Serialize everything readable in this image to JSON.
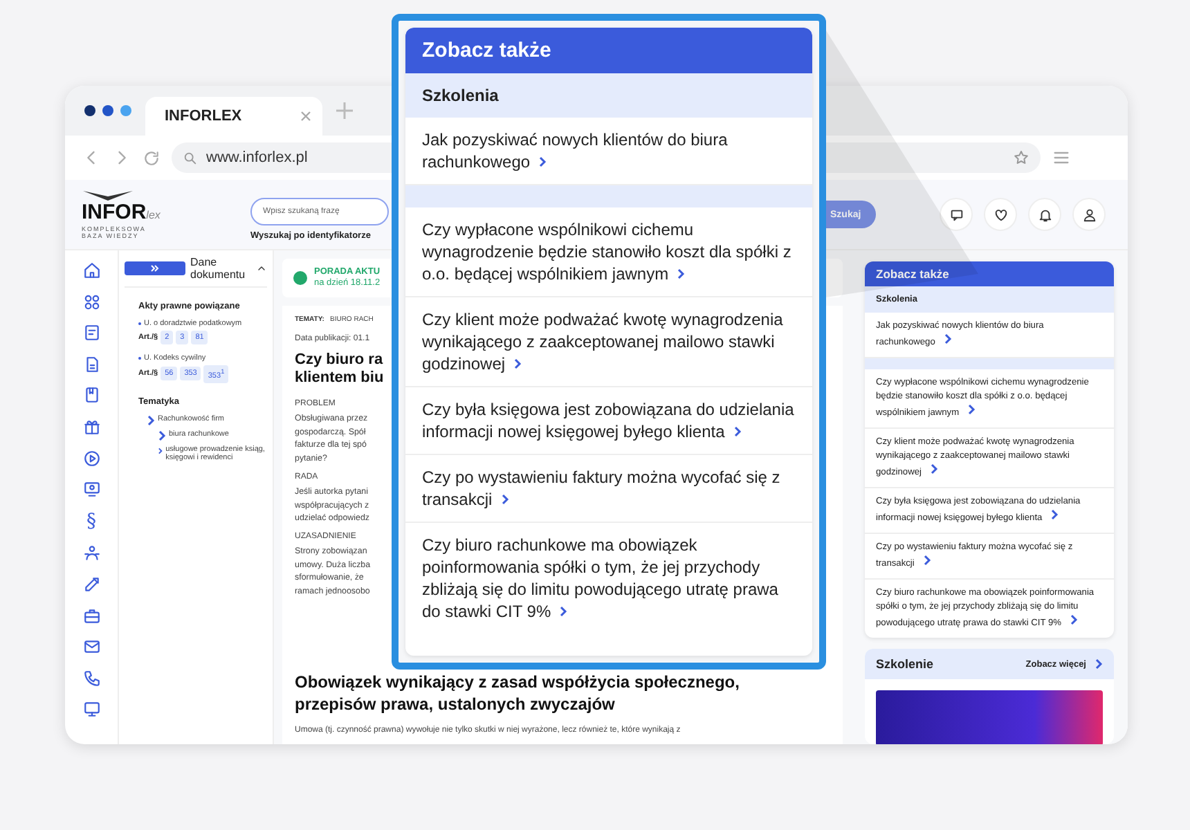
{
  "browser": {
    "tabs": [
      {
        "label": "INFORLEX",
        "selected": true
      }
    ],
    "url": "www.inforlex.pl"
  },
  "header": {
    "logo": {
      "brand": "INFOR",
      "suffix": "lex",
      "tagline_1": "KOMPLEKSOWA",
      "tagline_2": "BAZA WIEDZY"
    },
    "search": {
      "placeholder": "Wpisz szukaną frazę",
      "button": "Szukaj"
    },
    "id_search_link": "Wyszukaj po identyfikatorze"
  },
  "rail": {
    "symbol": "§"
  },
  "document_panel": {
    "title": "Dane dokumentu",
    "acts_title": "Akty prawne powiązane",
    "acts": [
      {
        "name": "U. o doradztwie podatkowym",
        "label": "Art./§",
        "articles": [
          "2",
          "3",
          "81"
        ]
      },
      {
        "name": "U. Kodeks cywilny",
        "label": "Art./§",
        "articles": [
          "56",
          "353",
          "353$^{1}$"
        ]
      }
    ],
    "topics_title": "Tematyka",
    "topics": [
      {
        "label": "Rachunkowość firm",
        "children": [
          {
            "label": "biura rachunkowe"
          },
          {
            "label": "usługowe prowadzenie ksiąg, księgowi i rewidenci"
          }
        ]
      }
    ]
  },
  "document": {
    "badge": {
      "title": "PORADA AKTU",
      "date": "na dzień 18.11.2"
    },
    "topics_label": "TEMATY:",
    "topics": "BIURO RACH",
    "published": "Data publikacji: 01.1",
    "title_lines": [
      "Czy biuro ra",
      "klientem biu"
    ],
    "blocks": [
      {
        "kind": "label",
        "lines": [
          "PROBLEM"
        ]
      },
      {
        "kind": "paragraph",
        "lines": [
          "Obsługiwana przez",
          "gospodarczą. Spół",
          "fakturze dla tej spó",
          "pytanie?"
        ]
      },
      {
        "kind": "label",
        "lines": [
          "RADA"
        ]
      },
      {
        "kind": "paragraph",
        "lines": [
          "Jeśli autorka pytani",
          "współpracujących z",
          "udzielać odpowiedz"
        ]
      },
      {
        "kind": "label",
        "lines": [
          "UZASADNIENIE"
        ]
      },
      {
        "kind": "paragraph",
        "lines": [
          "Strony zobowiązan",
          "umowy. Duża liczba",
          "sformułowanie, że",
          "ramach jednoosobo"
        ]
      }
    ],
    "heading_lines": [
      "Obowiązek wynikający z zasad współżycia społecznego,",
      "przepisów prawa, ustalonych zwyczajów"
    ],
    "body": "Umowa (tj. czynność prawna) wywołuje nie tylko skutki w niej wyrażone, lecz również te, które wynikają z"
  },
  "popup": {
    "title": "Zobacz także",
    "groups": [
      {
        "heading": "Szkolenia",
        "items": [
          "Jak pozyskiwać nowych klientów do biura rachunkowego"
        ]
      },
      {
        "items": [
          "Czy wypłacone wspólnikowi cichemu wynagrodzenie będzie stanowiło koszt dla spółki z o.o. będącej wspólnikiem jawnym",
          "Czy klient może podważać kwotę wynagrodzenia wynikającego z zaakceptowanej mailowo stawki godzinowej",
          "Czy była księgowa jest zobowiązana do udzielania informacji nowej księgowej byłego klienta",
          "Czy po wystawieniu faktury można wycofać się z transakcji",
          "Czy biuro rachunkowe ma obowiązek poinformowania spółki o tym, że jej przychody zbliżają się do limitu powodującego utratę prawa do stawki CIT 9%"
        ]
      }
    ]
  },
  "right_panel": {
    "see_also": {
      "title": "Zobacz także",
      "groups": [
        {
          "heading": "Szkolenia",
          "items": [
            "Jak pozyskiwać nowych klientów do biura rachunkowego"
          ]
        },
        {
          "items": [
            "Czy wypłacone wspólnikowi cichemu wynagrodzenie będzie stanowiło koszt dla spółki z o.o. będącej wspólnikiem jawnym",
            "Czy klient może podważać kwotę wynagrodzenia wynikającego z zaakceptowanej mailowo stawki godzinowej",
            "Czy była księgowa jest zobowiązana do udzielania informacji nowej księgowej byłego klienta",
            "Czy po wystawieniu faktury można wycofać się z transakcji",
            "Czy biuro rachunkowe ma obowiązek poinformowania spółki o tym, że jej przychody zbliżają się do limitu powodującego utratę prawa do stawki CIT 9%"
          ]
        }
      ]
    },
    "training": {
      "title": "Szkolenie",
      "more": "Zobacz więcej"
    }
  }
}
